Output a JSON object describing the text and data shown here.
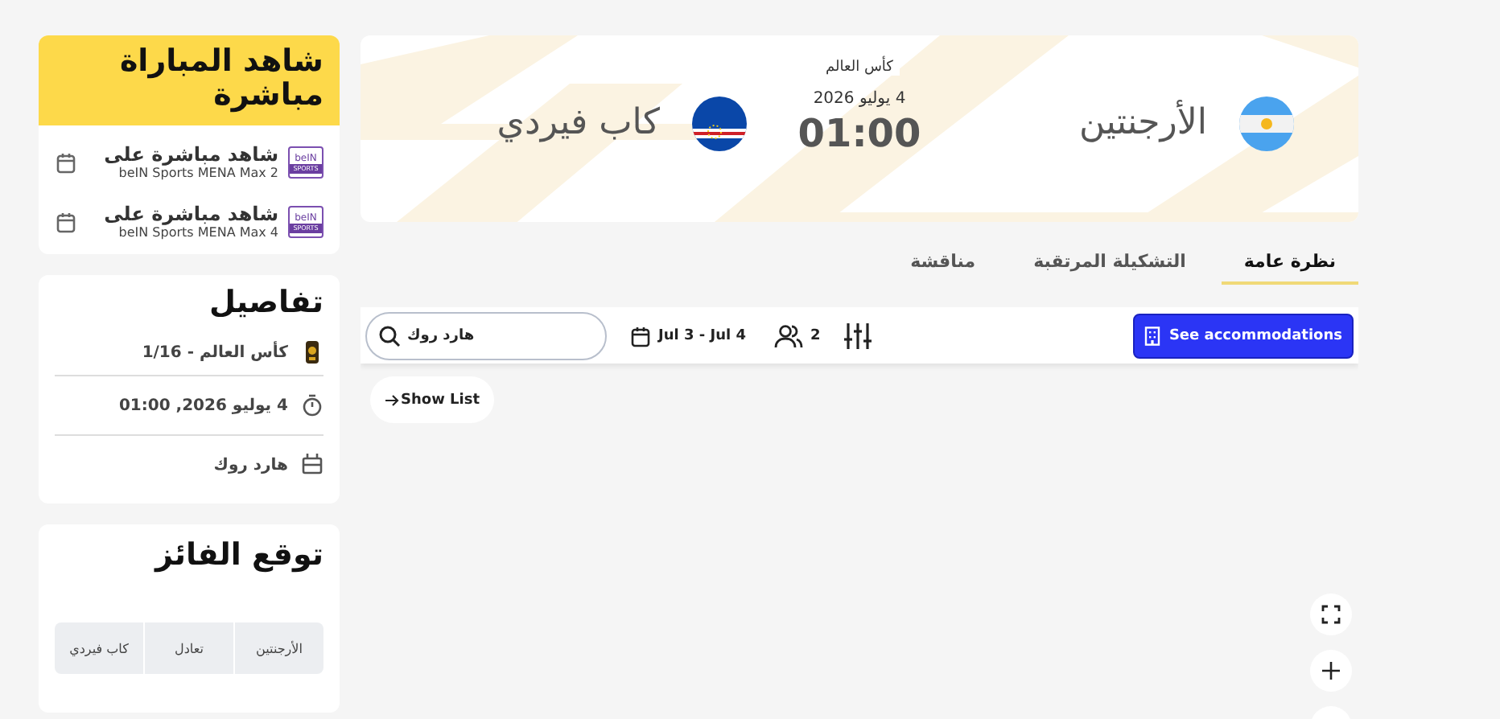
{
  "sidebar": {
    "watch_live": {
      "title": "شاهد المباراة مباشرة",
      "channels": [
        {
          "label": "شاهد مباشرة على",
          "channel": "beIN Sports MENA Max 2",
          "logo_text": "beIN",
          "logo_subtext": "SPORTS"
        },
        {
          "label": "شاهد مباشرة على",
          "channel": "beIN Sports MENA Max 4",
          "logo_text": "beIN",
          "logo_subtext": "SPORTS"
        }
      ]
    },
    "details": {
      "title": "تفاصيل",
      "items": [
        {
          "kind": "competition",
          "text": "كأس العالم - 1/16"
        },
        {
          "kind": "datetime",
          "text": "4 يوليو 2026, 01:00"
        },
        {
          "kind": "venue",
          "text": "هارد روك"
        }
      ]
    },
    "prediction": {
      "title": "توقع الفائز",
      "options": [
        "الأرجنتين",
        "تعادل",
        "كاب فيردي"
      ]
    }
  },
  "match": {
    "competition": "كأس العالم",
    "home": {
      "name": "الأرجنتين"
    },
    "away": {
      "name": "كاب فيردي"
    },
    "date": "4 يوليو 2026",
    "time": "01:00"
  },
  "tabs": [
    {
      "label": "نظرة عامة",
      "selected": true
    },
    {
      "label": "التشكيلة المرتقبة",
      "selected": false
    },
    {
      "label": "مناقشة",
      "selected": false
    }
  ],
  "map": {
    "search": {
      "value": "هارد روك"
    },
    "dates": "Jul 3 - Jul 4",
    "guests": "2",
    "book_button": "See accommodations",
    "show_list": "Show List"
  }
}
